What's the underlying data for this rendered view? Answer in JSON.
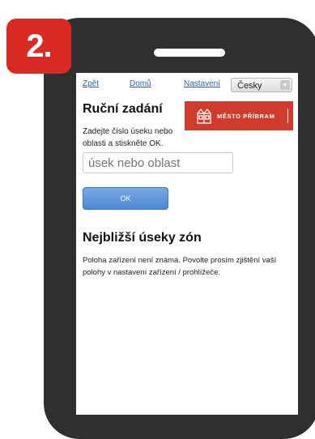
{
  "badge": {
    "label": "2."
  },
  "nav": {
    "back": "Zpět",
    "home": "Domů",
    "settings": "Nastavení",
    "language": "Česky"
  },
  "manual": {
    "title": "Ruční zadání",
    "instructions": "Zadejte číslo úseku nebo oblasti a stiskněte OK.",
    "input_placeholder": "úsek nebo oblast",
    "ok_label": "OK"
  },
  "logo": {
    "text": "MĚSTO PŘÍBRAM"
  },
  "nearest": {
    "title": "Nejbližší úseky zón",
    "message": "Poloha zařízení není známá. Povolte prosím zjištění vaší polohy v nastavení zařízení / prohlížeče."
  },
  "colors": {
    "badge": "#d92a23",
    "phone": "#2f2f2f",
    "logo_bg": "#d13b2c",
    "link": "#2b5fb8",
    "ok_button": "#5a93d9"
  }
}
